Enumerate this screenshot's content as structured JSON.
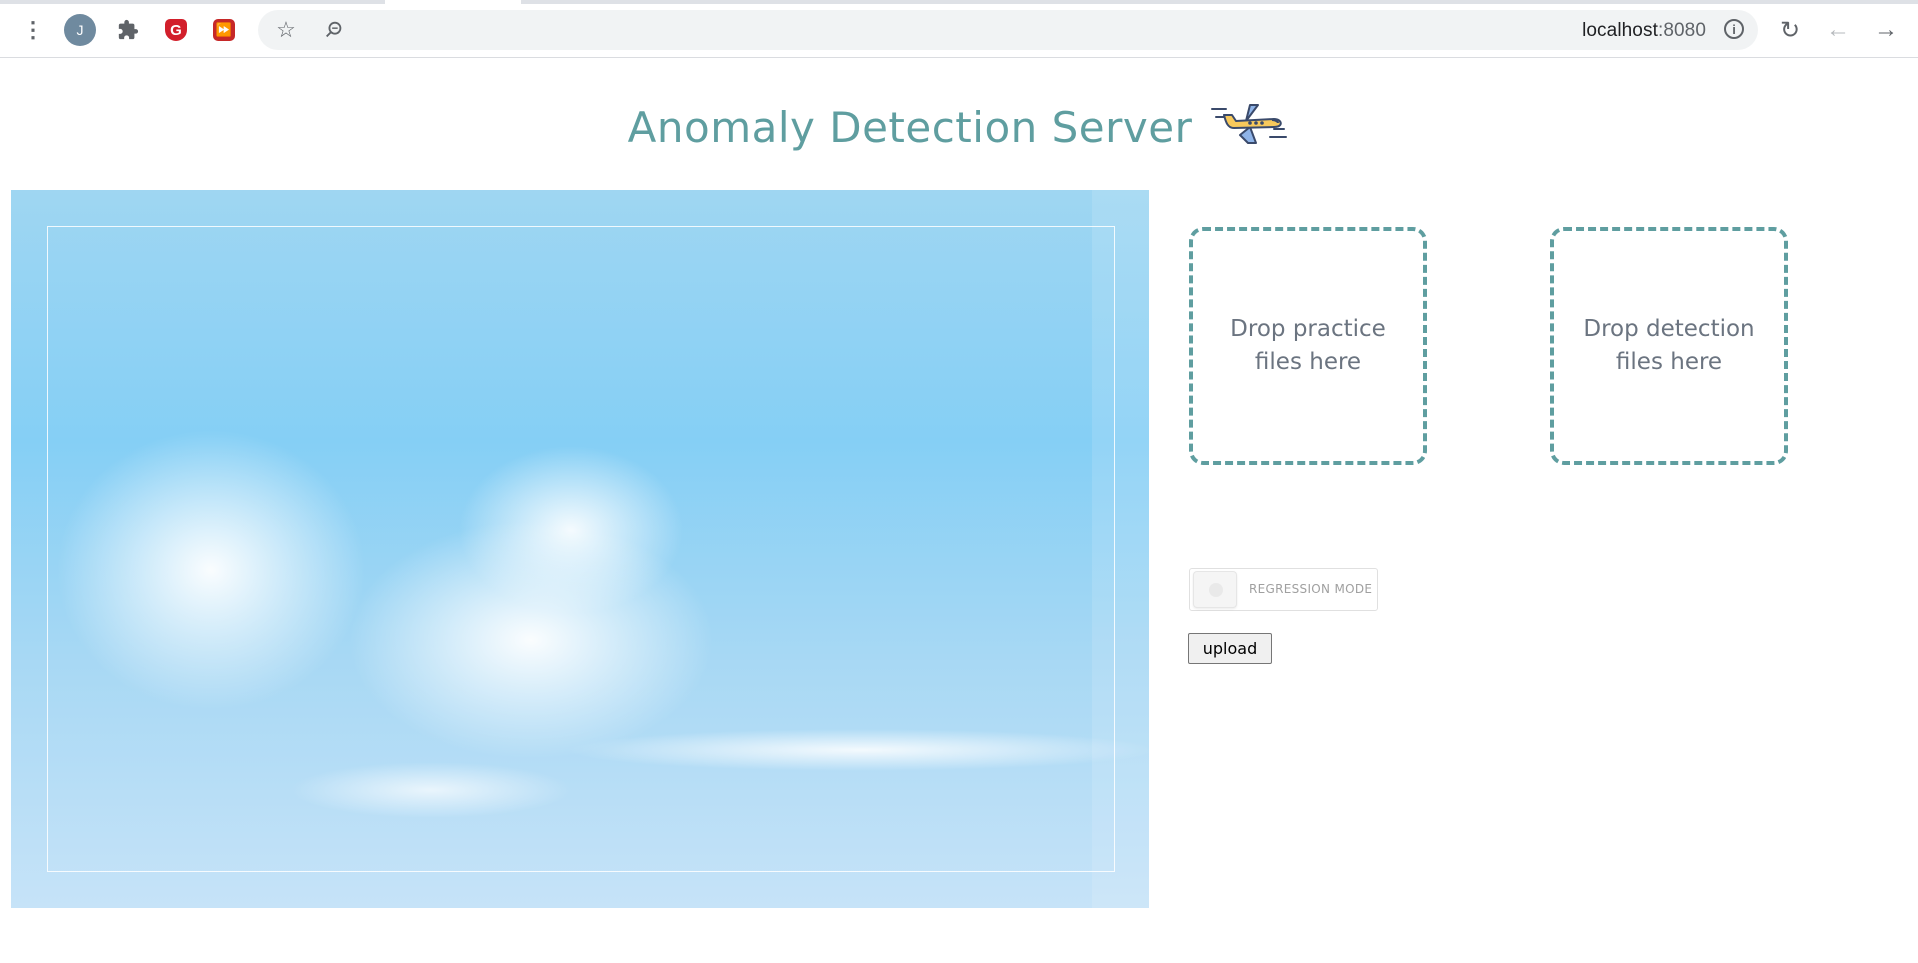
{
  "browser": {
    "avatar_initial": "J",
    "url_host": "localhost",
    "url_port": ":8080",
    "info_glyph": "i"
  },
  "page": {
    "title": "Anomaly Detection Server",
    "title_emoji": "airplane-icon",
    "practice_drop_label": "Drop practice files here",
    "detection_drop_label": "Drop detection files here",
    "regression_toggle_label": "REGRESSION MODE",
    "regression_mode_on": false,
    "upload_button_label": "upload"
  },
  "colors": {
    "accent": "#5f9ea0",
    "drop_text": "#6b7480",
    "sky_top": "#9fd6f2",
    "sky_bottom": "#c6e3f8"
  }
}
